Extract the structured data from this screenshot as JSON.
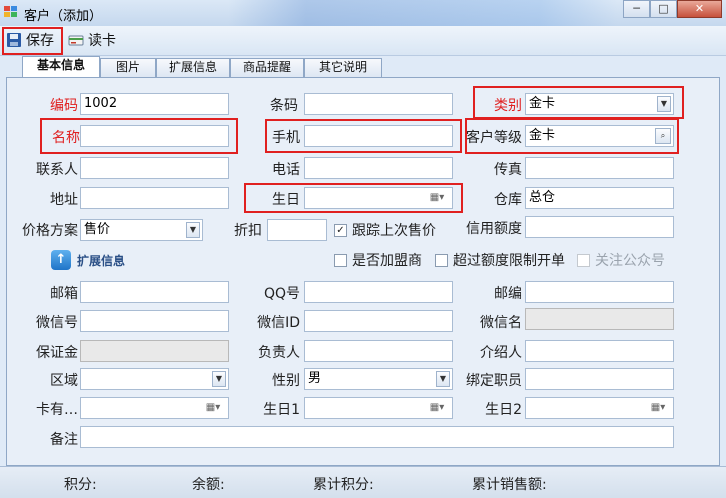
{
  "window": {
    "title": "客户（添加）",
    "controls": {
      "minimize": "─",
      "maximize": "□",
      "close": "✕"
    }
  },
  "toolbar": {
    "save_label": "保存",
    "read_card_label": "读卡"
  },
  "tabs": [
    "基本信息",
    "图片",
    "扩展信息",
    "商品提醒",
    "其它说明"
  ],
  "form": {
    "code_label": "编码",
    "code_value": "1002",
    "barcode_label": "条码",
    "barcode_value": "",
    "category_label": "类别",
    "category_value": "金卡",
    "name_label": "名称",
    "name_value": "",
    "mobile_label": "手机",
    "mobile_value": "",
    "customer_level_label": "客户等级",
    "customer_level_value": "金卡",
    "contact_label": "联系人",
    "contact_value": "",
    "phone_label": "电话",
    "phone_value": "",
    "fax_label": "传真",
    "fax_value": "",
    "address_label": "地址",
    "address_value": "",
    "birthday_label": "生日",
    "birthday_value": "",
    "warehouse_label": "仓库",
    "warehouse_value": "总仓",
    "price_scheme_label": "价格方案",
    "price_scheme_value": "售价",
    "discount_label": "折扣",
    "discount_value": "",
    "track_last_price_label": "跟踪上次售价",
    "track_last_price_checked": true,
    "credit_label": "信用额度",
    "credit_value": ""
  },
  "expand": {
    "label": "扩展信息"
  },
  "options": {
    "join_label": "是否加盟商",
    "join_checked": false,
    "over_limit_label": "超过额度限制开单",
    "over_limit_checked": false,
    "follow_label": "关注公众号",
    "follow_checked": false
  },
  "extended": {
    "email_label": "邮箱",
    "email_value": "",
    "qq_label": "QQ号",
    "qq_value": "",
    "postcode_label": "邮编",
    "postcode_value": "",
    "wechat_label": "微信号",
    "wechat_value": "",
    "wechat_id_label": "微信ID",
    "wechat_id_value": "",
    "wechat_name_label": "微信名",
    "wechat_name_value": "",
    "deposit_label": "保证金",
    "deposit_value": "",
    "person_in_charge_label": "负责人",
    "person_in_charge_value": "",
    "referrer_label": "介绍人",
    "referrer_value": "",
    "region_label": "区域",
    "region_value": "",
    "gender_label": "性别",
    "gender_value": "男",
    "bound_staff_label": "绑定职员",
    "bound_staff_value": "",
    "card_valid_label": "卡有…",
    "card_valid_value": "",
    "birthday1_label": "生日1",
    "birthday1_value": "",
    "birthday2_label": "生日2",
    "birthday2_value": "",
    "remark_label": "备注",
    "remark_value": ""
  },
  "status": {
    "points_label": "积分:",
    "balance_label": "余额:",
    "cumulative_points_label": "累计积分:",
    "cumulative_sales_label": "累计销售额:"
  },
  "colors": {
    "highlight": "#e02020",
    "required_label": "#e02020",
    "accent": "#1f74c8"
  },
  "icons": {
    "save": "floppy-disk-icon",
    "read_card": "card-reader-icon",
    "dropdown": "chevron-down-icon",
    "calendar": "calendar-icon",
    "search": "magnifier-icon",
    "expand": "arrow-up-icon"
  }
}
